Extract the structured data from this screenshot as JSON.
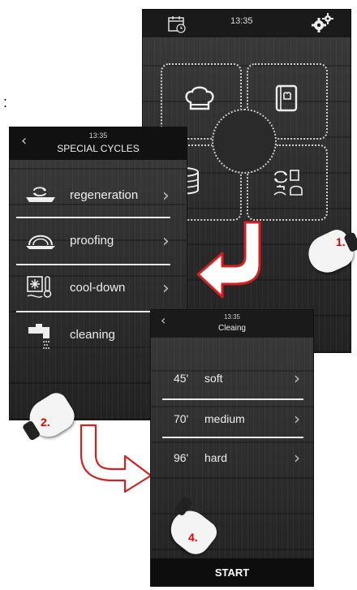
{
  "stray_colon": ":",
  "main_screen": {
    "time": "13:35",
    "icons": {
      "calendar": "calendar-clock-icon",
      "settings": "gears-icon",
      "tile_top_left": "chef-hat-icon",
      "tile_top_right": "recipe-book-icon",
      "tile_bottom_left": "layered-cake-icon",
      "tile_bottom_right": "special-cycles-icon"
    },
    "step_label": "1."
  },
  "special_cycles_screen": {
    "time": "13:35",
    "title": "SPECIAL CYCLES",
    "items": [
      {
        "label": "regeneration",
        "icon": "regeneration-icon"
      },
      {
        "label": "proofing",
        "icon": "proofing-icon"
      },
      {
        "label": "cool-down",
        "icon": "cool-down-icon"
      },
      {
        "label": "cleaning",
        "icon": "cleaning-tap-icon"
      }
    ],
    "step_label": "2."
  },
  "cleaning_screen": {
    "time": "13:35",
    "title": "Cleaing",
    "options": [
      {
        "duration": "45'",
        "label": "soft"
      },
      {
        "duration": "70'",
        "label": "medium"
      },
      {
        "duration": "96'",
        "label": "hard"
      }
    ],
    "start_label": "START",
    "step_label": "4."
  },
  "colors": {
    "step_red": "#e00000",
    "arrow_red": "#d42020",
    "screen_bg": "#2a2a2a"
  }
}
